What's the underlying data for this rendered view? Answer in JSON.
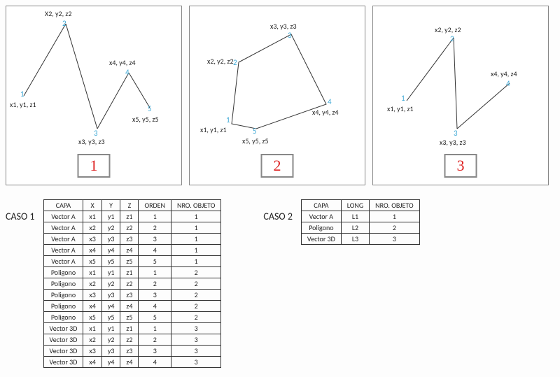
{
  "panels": [
    {
      "box_label": "1",
      "points": [
        {
          "n": "1",
          "c": "x1, y1, z1"
        },
        {
          "n": "2",
          "c": "X2, y2, z2"
        },
        {
          "n": "3",
          "c": "x3, y3, z3"
        },
        {
          "n": "4",
          "c": "x4, y4, z4"
        },
        {
          "n": "5",
          "c": "x5, y5, z5"
        }
      ]
    },
    {
      "box_label": "2",
      "points": [
        {
          "n": "1",
          "c": "x1, y1, z1"
        },
        {
          "n": "2",
          "c": "x2, y2, z2"
        },
        {
          "n": "3",
          "c": "x3, y3, z3"
        },
        {
          "n": "4",
          "c": "x4, y4, z4"
        },
        {
          "n": "5",
          "c": "x5, y5, z5"
        }
      ]
    },
    {
      "box_label": "3",
      "points": [
        {
          "n": "1",
          "c": "x1, y1, z1"
        },
        {
          "n": "2",
          "c": "x2, y2, z2"
        },
        {
          "n": "3",
          "c": "x3, y3, z3"
        },
        {
          "n": "4",
          "c": "x4, y4, z4"
        }
      ]
    }
  ],
  "caso1": {
    "label": "CASO 1",
    "headers": [
      "CAPA",
      "X",
      "Y",
      "Z",
      "ORDEN",
      "NRO. OBJETO"
    ],
    "rows": [
      [
        "Vector A",
        "x1",
        "y1",
        "z1",
        "1",
        "1"
      ],
      [
        "Vector A",
        "x2",
        "y2",
        "z2",
        "2",
        "1"
      ],
      [
        "Vector A",
        "x3",
        "y3",
        "z3",
        "3",
        "1"
      ],
      [
        "Vector A",
        "x4",
        "y4",
        "z4",
        "4",
        "1"
      ],
      [
        "Vector A",
        "x5",
        "y5",
        "z5",
        "5",
        "1"
      ],
      [
        "Poligono",
        "x1",
        "y1",
        "z1",
        "1",
        "2"
      ],
      [
        "Poligono",
        "x2",
        "y2",
        "z2",
        "2",
        "2"
      ],
      [
        "Poligono",
        "x3",
        "y3",
        "z3",
        "3",
        "2"
      ],
      [
        "Poligono",
        "x4",
        "y4",
        "z4",
        "4",
        "2"
      ],
      [
        "Poligono",
        "x5",
        "y5",
        "z5",
        "5",
        "2"
      ],
      [
        "Vector 3D",
        "x1",
        "y1",
        "z1",
        "1",
        "3"
      ],
      [
        "Vector 3D",
        "x2",
        "y2",
        "z2",
        "2",
        "3"
      ],
      [
        "Vector 3D",
        "x3",
        "y3",
        "z3",
        "3",
        "3"
      ],
      [
        "Vector 3D",
        "x4",
        "y4",
        "z4",
        "4",
        "3"
      ]
    ]
  },
  "caso2": {
    "label": "CASO 2",
    "headers": [
      "CAPA",
      "LONG",
      "NRO. OBJETO"
    ],
    "rows": [
      [
        "Vector A",
        "L1",
        "1"
      ],
      [
        "Poligono",
        "L2",
        "2"
      ],
      [
        "Vector 3D",
        "L3",
        "3"
      ]
    ]
  }
}
